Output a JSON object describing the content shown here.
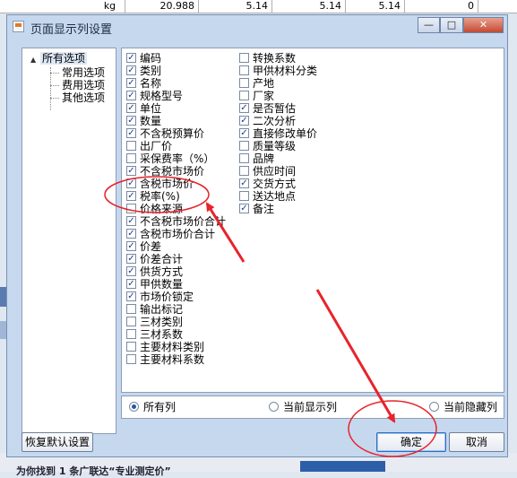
{
  "background": {
    "row_cells": [
      "kg",
      "20.988",
      "5.14",
      "5.14",
      "5.14",
      "0"
    ],
    "bottom_text": "为你找到 1 条广联达“专业测定价”"
  },
  "dialog": {
    "title": "页面显示列设置",
    "win_buttons": {
      "minimize": "—",
      "maximize": "□",
      "close": "✕"
    },
    "tree": {
      "root": "所有选项",
      "children": [
        "常用选项",
        "费用选项",
        "其他选项"
      ]
    },
    "columns_left": [
      {
        "label": "编码",
        "checked": true
      },
      {
        "label": "类别",
        "checked": true
      },
      {
        "label": "名称",
        "checked": true
      },
      {
        "label": "规格型号",
        "checked": true
      },
      {
        "label": "单位",
        "checked": true
      },
      {
        "label": "数量",
        "checked": true
      },
      {
        "label": "不含税预算价",
        "checked": true
      },
      {
        "label": "出厂价",
        "checked": false
      },
      {
        "label": "采保费率（%）",
        "checked": false
      },
      {
        "label": "不含税市场价",
        "checked": true
      },
      {
        "label": "含税市场价",
        "checked": true
      },
      {
        "label": "税率(%)",
        "checked": true
      },
      {
        "label": "价格来源",
        "checked": false
      },
      {
        "label": "不含税市场价合计",
        "checked": true
      },
      {
        "label": "含税市场价合计",
        "checked": true
      },
      {
        "label": "价差",
        "checked": true
      },
      {
        "label": "价差合计",
        "checked": true
      },
      {
        "label": "供货方式",
        "checked": true
      },
      {
        "label": "甲供数量",
        "checked": true
      },
      {
        "label": "市场价锁定",
        "checked": true
      },
      {
        "label": "输出标记",
        "checked": false
      },
      {
        "label": "三材类别",
        "checked": false
      },
      {
        "label": "三材系数",
        "checked": false
      },
      {
        "label": "主要材料类别",
        "checked": false
      },
      {
        "label": "主要材料系数",
        "checked": false
      }
    ],
    "columns_right": [
      {
        "label": "转换系数",
        "checked": false
      },
      {
        "label": "甲供材料分类",
        "checked": false
      },
      {
        "label": "产地",
        "checked": false
      },
      {
        "label": "厂家",
        "checked": false
      },
      {
        "label": "是否暂估",
        "checked": true
      },
      {
        "label": "二次分析",
        "checked": true
      },
      {
        "label": "直接修改单价",
        "checked": true
      },
      {
        "label": "质量等级",
        "checked": false
      },
      {
        "label": "品牌",
        "checked": false
      },
      {
        "label": "供应时间",
        "checked": false
      },
      {
        "label": "交货方式",
        "checked": true
      },
      {
        "label": "送达地点",
        "checked": false
      },
      {
        "label": "备注",
        "checked": true
      }
    ],
    "radio_options": [
      {
        "label": "所有列",
        "selected": true
      },
      {
        "label": "当前显示列",
        "selected": false
      },
      {
        "label": "当前隐藏列",
        "selected": false
      }
    ],
    "restore_label": "恢复默认设置",
    "ok_label": "确定",
    "cancel_label": "取消",
    "check_mark": "✓"
  },
  "colors": {
    "annotation": "#e8232a",
    "dialog_bg": "#c6d8ee",
    "check": "#1b3c8c"
  }
}
